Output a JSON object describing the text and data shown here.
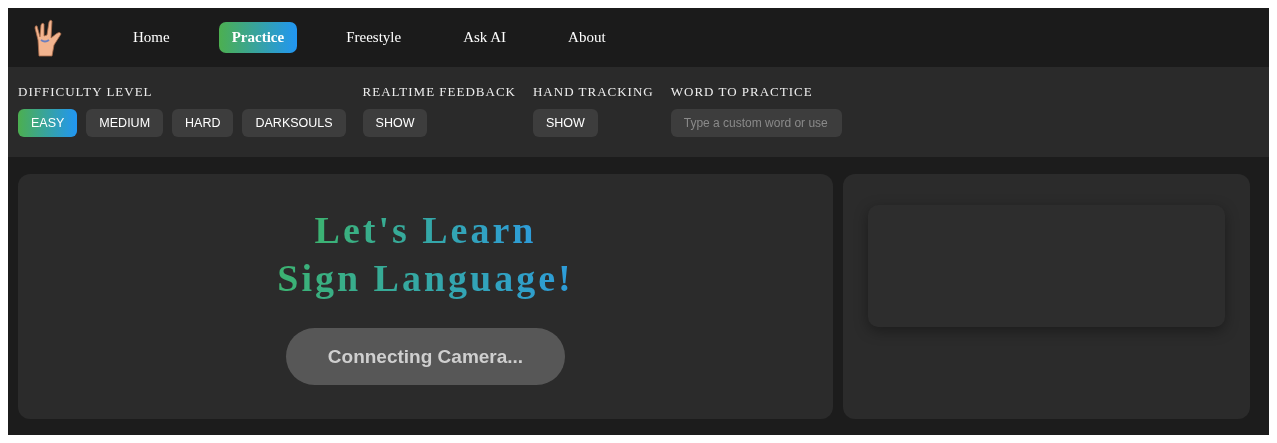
{
  "nav": {
    "items": [
      {
        "label": "Home",
        "selected": false
      },
      {
        "label": "Practice",
        "selected": true
      },
      {
        "label": "Freestyle",
        "selected": false
      },
      {
        "label": "Ask AI",
        "selected": false
      },
      {
        "label": "About",
        "selected": false
      }
    ]
  },
  "controls": {
    "groups": [
      {
        "title": "DIFFICULTY LEVEL",
        "options": [
          {
            "label": "EASY",
            "selected": true
          },
          {
            "label": "MEDIUM",
            "selected": false
          },
          {
            "label": "HARD",
            "selected": false
          },
          {
            "label": "DARKSOULS",
            "selected": false
          }
        ]
      },
      {
        "title": "REALTIME FEEDBACK",
        "options": [
          {
            "label": "SHOW",
            "selected": false
          }
        ]
      },
      {
        "title": "HAND TRACKING",
        "options": [
          {
            "label": "SHOW",
            "selected": false
          }
        ]
      }
    ],
    "word": {
      "title": "WORD TO PRACTICE",
      "placeholder": "Type a custom word or use"
    }
  },
  "practice": {
    "heading_lines": [
      "Let's Learn",
      "Sign Language!"
    ],
    "status": "Connecting Camera..."
  }
}
